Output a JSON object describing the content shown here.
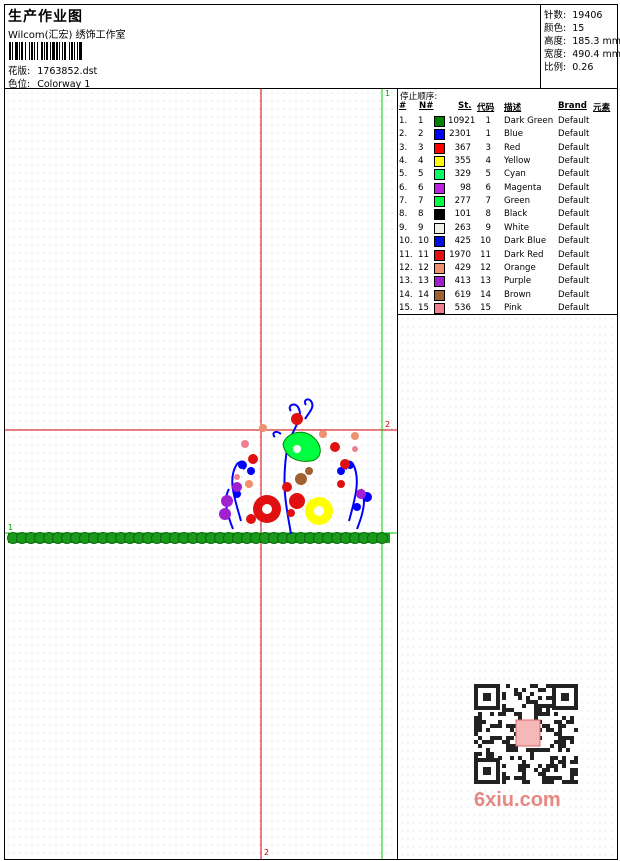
{
  "header": {
    "title": "生产作业图",
    "company": "Wilcom(汇宏) 绣饰工作室",
    "file_label": "花版:",
    "file_name": "1763852.dst",
    "colorway_label": "色位:",
    "colorway_name": "Colorway 1"
  },
  "stats": {
    "stitches_label": "针数:",
    "stitches_value": "19406",
    "colors_label": "颜色:",
    "colors_value": "15",
    "height_label": "高度:",
    "height_value": "185.3 mm",
    "width_label": "宽度:",
    "width_value": "490.4 mm",
    "scale_label": "比例:",
    "scale_value": "0.26"
  },
  "design": {
    "top_marker": "1",
    "left_marker": "1",
    "h_marker": "2",
    "v_marker": "2"
  },
  "color_table": {
    "title": "停止顺序:",
    "headers": {
      "num": "#",
      "no": "N#",
      "st": "St.",
      "code": "代码",
      "desc": "描述",
      "brand": "Brand",
      "elem": "元素"
    },
    "rows": [
      {
        "idx": "1.",
        "n": "1",
        "color": "#008000",
        "st": "10921",
        "code": "1",
        "desc": "Dark Green",
        "brand": "Default"
      },
      {
        "idx": "2.",
        "n": "2",
        "color": "#0000ff",
        "st": "2301",
        "code": "1",
        "desc": "Blue",
        "brand": "Default"
      },
      {
        "idx": "3.",
        "n": "3",
        "color": "#ff0000",
        "st": "367",
        "code": "3",
        "desc": "Red",
        "brand": "Default"
      },
      {
        "idx": "4.",
        "n": "4",
        "color": "#ffff00",
        "st": "355",
        "code": "4",
        "desc": "Yellow",
        "brand": "Default"
      },
      {
        "idx": "5.",
        "n": "5",
        "color": "#00ff66",
        "st": "329",
        "code": "5",
        "desc": "Cyan",
        "brand": "Default"
      },
      {
        "idx": "6.",
        "n": "6",
        "color": "#c020e0",
        "st": "98",
        "code": "6",
        "desc": "Magenta",
        "brand": "Default"
      },
      {
        "idx": "7.",
        "n": "7",
        "color": "#00ff40",
        "st": "277",
        "code": "7",
        "desc": "Green",
        "brand": "Default"
      },
      {
        "idx": "8.",
        "n": "8",
        "color": "#000000",
        "st": "101",
        "code": "8",
        "desc": "Black",
        "brand": "Default"
      },
      {
        "idx": "9.",
        "n": "9",
        "color": "#f0f0e8",
        "st": "263",
        "code": "9",
        "desc": "White",
        "brand": "Default"
      },
      {
        "idx": "10.",
        "n": "10",
        "color": "#0010e0",
        "st": "425",
        "code": "10",
        "desc": "Dark Blue",
        "brand": "Default"
      },
      {
        "idx": "11.",
        "n": "11",
        "color": "#e01010",
        "st": "1970",
        "code": "11",
        "desc": "Dark Red",
        "brand": "Default"
      },
      {
        "idx": "12.",
        "n": "12",
        "color": "#f09070",
        "st": "429",
        "code": "12",
        "desc": "Orange",
        "brand": "Default"
      },
      {
        "idx": "13.",
        "n": "13",
        "color": "#a020d0",
        "st": "413",
        "code": "13",
        "desc": "Purple",
        "brand": "Default"
      },
      {
        "idx": "14.",
        "n": "14",
        "color": "#a06030",
        "st": "619",
        "code": "14",
        "desc": "Brown",
        "brand": "Default"
      },
      {
        "idx": "15.",
        "n": "15",
        "color": "#f08090",
        "st": "536",
        "code": "15",
        "desc": "Pink",
        "brand": "Default"
      }
    ]
  },
  "watermark": {
    "text": "6xiu.com"
  },
  "colors": {
    "guide_red": "#cc0000",
    "guide_green": "#00cc00",
    "border_green": "#1a9a1a"
  }
}
